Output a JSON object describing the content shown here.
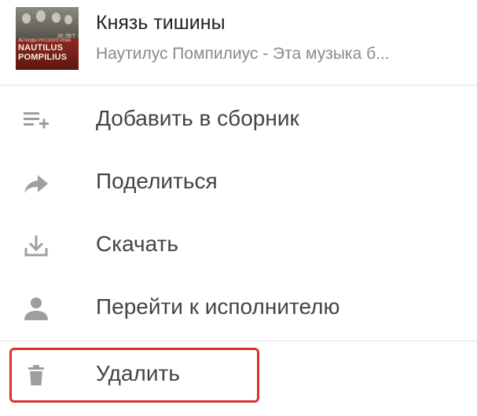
{
  "track": {
    "title": "Князь тишины",
    "subtitle": "Наутилус Помпилиус - Эта музыка б...",
    "cover": {
      "line1": "NAUTILUS",
      "line2": "POMPILIUS",
      "tag": "30 ЛЕТ",
      "small": "ЛЕГЕНДЫ РУССКОГО РОКА"
    }
  },
  "menu": {
    "items": [
      {
        "label": "Добавить в сборник",
        "icon": "playlist-add-icon"
      },
      {
        "label": "Поделиться",
        "icon": "share-icon"
      },
      {
        "label": "Скачать",
        "icon": "download-icon"
      },
      {
        "label": "Перейти к исполнителю",
        "icon": "person-icon"
      },
      {
        "label": "Удалить",
        "icon": "trash-icon"
      }
    ]
  },
  "colors": {
    "icon": "#9e9e9e",
    "label": "#444444",
    "highlight": "#d9322f",
    "divider": "#e3e3e3"
  }
}
